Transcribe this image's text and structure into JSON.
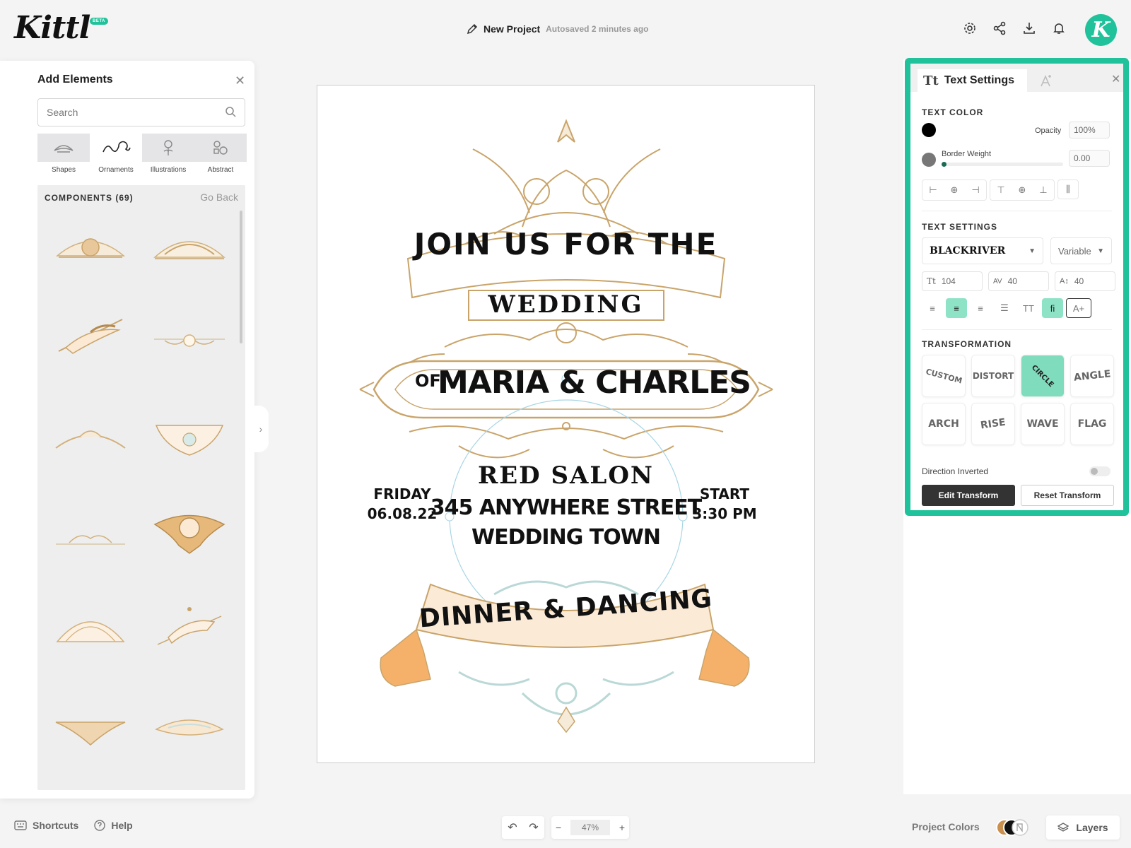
{
  "app": {
    "logo": "Kittl",
    "beta_badge": "BETA"
  },
  "header": {
    "project_name": "New Project",
    "autosave": "Autosaved 2 minutes ago",
    "avatar_letter": "K"
  },
  "add_elements": {
    "title": "Add Elements",
    "search_placeholder": "Search",
    "categories": [
      {
        "label": "Shapes",
        "icon": "shapes-icon"
      },
      {
        "label": "Ornaments",
        "icon": "ornaments-icon"
      },
      {
        "label": "Illustrations",
        "icon": "illustrations-icon"
      },
      {
        "label": "Abstract",
        "icon": "abstract-icon"
      }
    ],
    "components_label": "COMPONENTS (69)",
    "go_back": "Go Back",
    "collapse_icon": "chevron-right-icon"
  },
  "poster": {
    "line1": "JOIN US FOR THE",
    "line2": "WEDDING",
    "of": "OF",
    "names": "MARIA & CHARLES",
    "venue": "RED SALON",
    "address1": "345 ANYWHERE STREET",
    "address2": "WEDDING TOWN",
    "day": "FRIDAY",
    "date": "06.08.22",
    "start": "START",
    "time": "3:30 PM",
    "banner": "DINNER & DANCING"
  },
  "text_settings": {
    "tab_title": "Text Settings",
    "text_color_label": "TEXT COLOR",
    "text_color": "#000000",
    "opacity_label": "Opacity",
    "opacity_value": "100%",
    "border_weight_label": "Border Weight",
    "border_weight_value": "0.00",
    "border_color": "#777777",
    "text_settings_label": "TEXT SETTINGS",
    "font_name": "BLACKRIVER",
    "font_variant": "Variable",
    "font_size": "104",
    "letter_spacing": "40",
    "line_height": "40",
    "transformation_label": "TRANSFORMATION",
    "transforms": [
      "CUSTOM",
      "DISTORT",
      "CIRCLE",
      "ANGLE",
      "ARCH",
      "RISE",
      "WAVE",
      "FLAG"
    ],
    "direction_inverted": "Direction Inverted",
    "edit_transform": "Edit Transform",
    "reset_transform": "Reset Transform"
  },
  "bottom": {
    "shortcuts": "Shortcuts",
    "help": "Help",
    "zoom": "47%",
    "project_colors": "Project Colors",
    "layers": "Layers"
  },
  "colors": {
    "accent": "#1fc29a",
    "ornament_gold": "#c9a46a",
    "ribbon_peach": "#fde9d6",
    "ribbon_orange": "#f5b16a",
    "ornament_blue": "#c7dede"
  }
}
